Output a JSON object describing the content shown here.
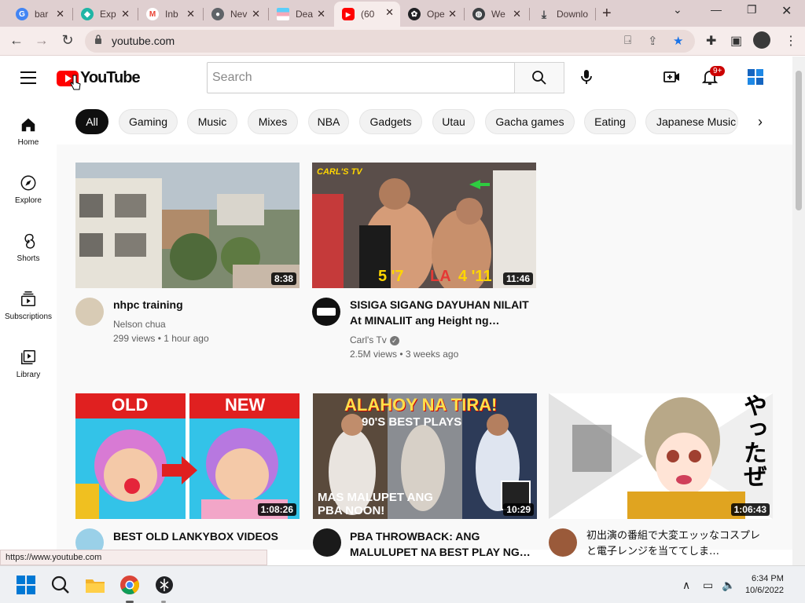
{
  "browser": {
    "tabs": [
      {
        "title": "bar",
        "favicon": "google-icon",
        "color": "#4285f4"
      },
      {
        "title": "Exp",
        "favicon": "expedition-icon",
        "color": "#1fb5a5"
      },
      {
        "title": "Inb",
        "favicon": "gmail-icon",
        "color": "#ea4335"
      },
      {
        "title": "Nev",
        "favicon": "chrome-icon",
        "color": "#5f6368"
      },
      {
        "title": "Dea",
        "favicon": "flag-icon",
        "color": "#f4a8c0"
      },
      {
        "title": "(60",
        "favicon": "youtube-icon",
        "color": "#ff0000"
      },
      {
        "title": "Ope",
        "favicon": "openai-icon",
        "color": "#202124"
      },
      {
        "title": "We",
        "favicon": "globe-icon",
        "color": "#3c4043"
      },
      {
        "title": "Downlo",
        "favicon": "download-icon",
        "color": "#3c4043"
      }
    ],
    "url": "youtube.com",
    "status_url": "https://www.youtube.com"
  },
  "youtube": {
    "logo_text": "YouTube",
    "search_placeholder": "Search",
    "notification_count": "9+",
    "chips": [
      "All",
      "Gaming",
      "Music",
      "Mixes",
      "NBA",
      "Gadgets",
      "Utau",
      "Gacha games",
      "Eating",
      "Japanese Music"
    ],
    "guide": [
      {
        "label": "Home",
        "icon": "home-icon"
      },
      {
        "label": "Explore",
        "icon": "compass-icon"
      },
      {
        "label": "Shorts",
        "icon": "shorts-icon"
      },
      {
        "label": "Subscriptions",
        "icon": "subscriptions-icon"
      },
      {
        "label": "Library",
        "icon": "library-icon"
      }
    ],
    "videos": [
      {
        "title": "nhpc training",
        "channel": "Nelson chua",
        "meta": "299 views • 1 hour ago",
        "duration": "8:38"
      },
      {
        "title": "SISIGA SIGANG DAYUHAN NILAIT At MINALIIT ang Height ng…",
        "channel": "Carl's Tv",
        "meta": "2.5M views • 3 weeks ago",
        "duration": "11:46"
      },
      {
        "title": "BEST OLD LANKYBOX VIDEOS",
        "duration": "1:08:26"
      },
      {
        "title": "PBA THROWBACK: ANG MALULUPET NA BEST PLAY NG…",
        "duration": "10:29"
      },
      {
        "title": "初出演の番組で大変エッッなコスプレと電子レンジを当ててしま…",
        "duration": "1:06:43"
      }
    ],
    "thumb_text": {
      "carl_tv": "CARL'S TV",
      "height_left": "5 '7",
      "height_mid": "LA",
      "height_right": "4 '11",
      "old": "OLD",
      "new": "NEW",
      "alahoy": "ALAHOY NA TIRA!",
      "best_plays": "90'S BEST PLAYS",
      "malupet_1": "MAS MALUPET ANG",
      "malupet_2": "PBA NOON!",
      "jp_vertical": "やったぜ"
    }
  },
  "taskbar": {
    "time": "6:34 PM",
    "date": "10/6/2022"
  }
}
